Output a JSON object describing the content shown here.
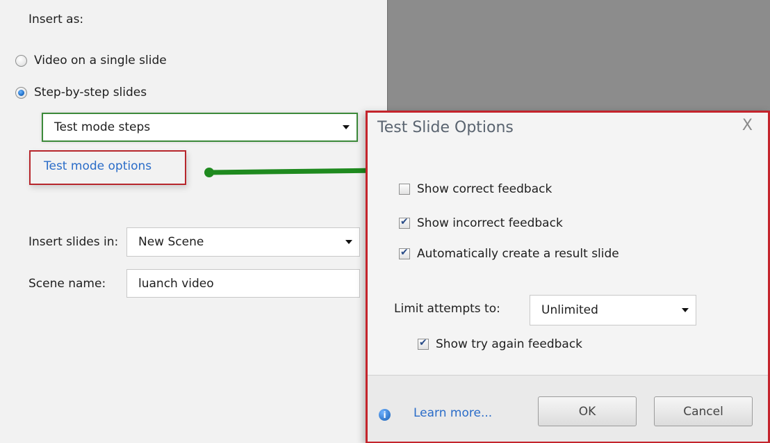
{
  "left": {
    "insert_as_label": "Insert as:",
    "radio_video": "Video on a single slide",
    "radio_steps": "Step-by-step slides",
    "steps_selected": "Test mode steps",
    "test_mode_link": "Test mode options",
    "insert_slides_label": "Insert slides in:",
    "insert_slides_value": "New Scene",
    "scene_name_label": "Scene name:",
    "scene_name_value": "luanch video"
  },
  "dialog": {
    "title": "Test Slide Options",
    "close_glyph": "X",
    "options": [
      {
        "label": "Show correct feedback",
        "checked": false
      },
      {
        "label": "Show incorrect feedback",
        "checked": true
      },
      {
        "label": "Automatically create a result slide",
        "checked": true
      }
    ],
    "limit_label": "Limit attempts to:",
    "limit_value": "Unlimited",
    "try_again_label": "Show try again feedback",
    "try_again_checked": true,
    "info_glyph": "i",
    "learn_more": "Learn more...",
    "ok": "OK",
    "cancel": "Cancel"
  },
  "colors": {
    "highlight_red": "#c4242c",
    "highlight_green": "#3c8a3a",
    "link_blue": "#2a6cc8",
    "arrow_green": "#1f8a1f"
  }
}
